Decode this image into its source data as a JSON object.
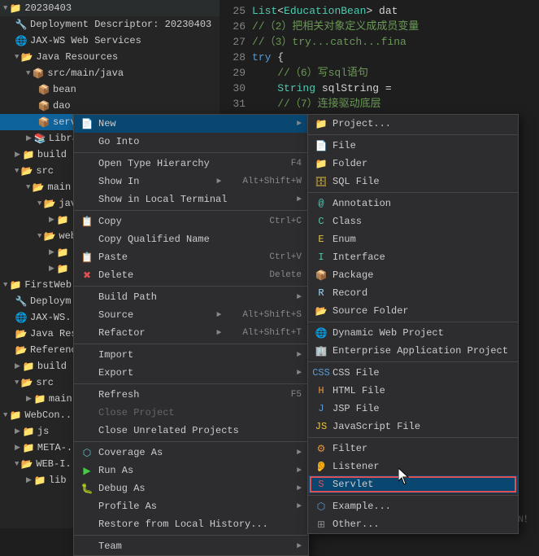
{
  "tree": {
    "items": [
      {
        "id": "20230403",
        "label": "20230403",
        "indent": 1,
        "type": "project",
        "expanded": true
      },
      {
        "id": "deployment",
        "label": "Deployment Descriptor: 20230403",
        "indent": 2,
        "type": "descriptor"
      },
      {
        "id": "jaxws",
        "label": "JAX-WS Web Services",
        "indent": 2,
        "type": "service"
      },
      {
        "id": "java-resources",
        "label": "Java Resources",
        "indent": 2,
        "type": "folder",
        "expanded": true
      },
      {
        "id": "src-main-java",
        "label": "src/main/java",
        "indent": 3,
        "type": "src",
        "expanded": true
      },
      {
        "id": "bean",
        "label": "bean",
        "indent": 4,
        "type": "package"
      },
      {
        "id": "dao",
        "label": "dao",
        "indent": 4,
        "type": "package"
      },
      {
        "id": "servlet",
        "label": "servlet",
        "indent": 4,
        "type": "package",
        "selected": true
      },
      {
        "id": "librar",
        "label": "Librar...",
        "indent": 3,
        "type": "library"
      },
      {
        "id": "build",
        "label": "build",
        "indent": 2,
        "type": "folder"
      },
      {
        "id": "src",
        "label": "src",
        "indent": 2,
        "type": "folder",
        "expanded": true
      },
      {
        "id": "main",
        "label": "main",
        "indent": 3,
        "type": "folder",
        "expanded": true
      },
      {
        "id": "jav",
        "label": "jav...",
        "indent": 4,
        "type": "folder",
        "expanded": true
      },
      {
        "id": "jav-sub1",
        "label": "►",
        "indent": 5,
        "type": "folder"
      },
      {
        "id": "web",
        "label": "web...",
        "indent": 4,
        "type": "folder",
        "expanded": true
      },
      {
        "id": "web-sub1",
        "label": "►",
        "indent": 5,
        "type": "folder"
      },
      {
        "id": "web-sub2",
        "label": "►",
        "indent": 5,
        "type": "folder"
      },
      {
        "id": "firstweb",
        "label": "FirstWeb",
        "indent": 1,
        "type": "project"
      },
      {
        "id": "deploym2",
        "label": "Deploym...",
        "indent": 2,
        "type": "descriptor"
      },
      {
        "id": "jaxws2",
        "label": "JAX-WS...",
        "indent": 2,
        "type": "service"
      },
      {
        "id": "java-res2",
        "label": "Java Res...",
        "indent": 2,
        "type": "folder"
      },
      {
        "id": "reference",
        "label": "Reference...",
        "indent": 2,
        "type": "folder"
      },
      {
        "id": "build2",
        "label": "build",
        "indent": 2,
        "type": "folder"
      },
      {
        "id": "src2",
        "label": "src",
        "indent": 2,
        "type": "folder",
        "expanded": true
      },
      {
        "id": "main2",
        "label": "main",
        "indent": 3,
        "type": "folder"
      },
      {
        "id": "webcon",
        "label": "WebCon...",
        "indent": 1,
        "type": "project",
        "expanded": true
      },
      {
        "id": "js",
        "label": "js",
        "indent": 2,
        "type": "folder"
      },
      {
        "id": "meta",
        "label": "META-...",
        "indent": 2,
        "type": "folder"
      },
      {
        "id": "web-inf",
        "label": "WEB-I...",
        "indent": 2,
        "type": "folder"
      },
      {
        "id": "lib",
        "label": "lib",
        "indent": 3,
        "type": "folder"
      }
    ]
  },
  "code": {
    "lines": [
      {
        "num": "25",
        "content": "List<EducationBean> dat"
      },
      {
        "num": "26",
        "content": "//（2）把相关对象定义成成员变量"
      },
      {
        "num": "27",
        "content": "//（3）try...catch...fina"
      },
      {
        "num": "28",
        "content": "try {"
      },
      {
        "num": "29",
        "content": "//（6）写sql语句"
      },
      {
        "num": "30",
        "content": "String sqlString ="
      },
      {
        "num": "31",
        "content": "//（7）连接驱动底层"
      }
    ]
  },
  "contextMenu": {
    "items": [
      {
        "id": "new",
        "label": "New",
        "shortcut": "",
        "hasArrow": true,
        "icon": "new-icon",
        "active": true
      },
      {
        "id": "go-into",
        "label": "Go Into",
        "shortcut": ""
      },
      {
        "id": "separator1",
        "type": "separator"
      },
      {
        "id": "open-type-hierarchy",
        "label": "Open Type Hierarchy",
        "shortcut": "F4"
      },
      {
        "id": "show-in",
        "label": "Show In",
        "shortcut": "Alt+Shift+W",
        "hasArrow": true
      },
      {
        "id": "show-local",
        "label": "Show in Local Terminal",
        "shortcut": "",
        "hasArrow": true
      },
      {
        "id": "separator2",
        "type": "separator"
      },
      {
        "id": "copy",
        "label": "Copy",
        "shortcut": "Ctrl+C",
        "icon": "copy-icon"
      },
      {
        "id": "copy-qualified",
        "label": "Copy Qualified Name",
        "shortcut": ""
      },
      {
        "id": "paste",
        "label": "Paste",
        "shortcut": "Ctrl+V",
        "icon": "paste-icon"
      },
      {
        "id": "delete",
        "label": "Delete",
        "shortcut": "Delete",
        "icon": "delete-icon"
      },
      {
        "id": "separator3",
        "type": "separator"
      },
      {
        "id": "build-path",
        "label": "Build Path",
        "shortcut": "",
        "hasArrow": true
      },
      {
        "id": "source",
        "label": "Source",
        "shortcut": "Alt+Shift+S",
        "hasArrow": true
      },
      {
        "id": "refactor",
        "label": "Refactor",
        "shortcut": "Alt+Shift+T",
        "hasArrow": true
      },
      {
        "id": "separator4",
        "type": "separator"
      },
      {
        "id": "import",
        "label": "Import",
        "shortcut": "",
        "hasArrow": true
      },
      {
        "id": "export",
        "label": "Export",
        "shortcut": "",
        "hasArrow": true
      },
      {
        "id": "separator5",
        "type": "separator"
      },
      {
        "id": "refresh",
        "label": "Refresh",
        "shortcut": "F5"
      },
      {
        "id": "close-project",
        "label": "Close Project",
        "shortcut": "",
        "disabled": true
      },
      {
        "id": "close-unrelated",
        "label": "Close Unrelated Projects",
        "shortcut": ""
      },
      {
        "id": "separator6",
        "type": "separator"
      },
      {
        "id": "coverage-as",
        "label": "Coverage As",
        "shortcut": "",
        "hasArrow": true,
        "icon": "coverage-icon"
      },
      {
        "id": "run-as",
        "label": "Run As",
        "shortcut": "",
        "hasArrow": true,
        "icon": "run-icon"
      },
      {
        "id": "debug-as",
        "label": "Debug As",
        "shortcut": "",
        "hasArrow": true,
        "icon": "debug-icon"
      },
      {
        "id": "profile-as",
        "label": "Profile As",
        "shortcut": "",
        "hasArrow": true
      },
      {
        "id": "restore",
        "label": "Restore from Local History...",
        "shortcut": ""
      },
      {
        "id": "separator7",
        "type": "separator"
      },
      {
        "id": "team",
        "label": "Team",
        "shortcut": "",
        "hasArrow": true
      }
    ]
  },
  "submenu": {
    "items": [
      {
        "id": "project",
        "label": "Project...",
        "icon": "project-icon"
      },
      {
        "id": "separator1",
        "type": "separator"
      },
      {
        "id": "file",
        "label": "File",
        "icon": "file-icon"
      },
      {
        "id": "folder",
        "label": "Folder",
        "icon": "folder-icon"
      },
      {
        "id": "sql-file",
        "label": "SQL File",
        "icon": "sql-icon"
      },
      {
        "id": "separator2",
        "type": "separator"
      },
      {
        "id": "annotation",
        "label": "Annotation",
        "icon": "annotation-icon"
      },
      {
        "id": "class",
        "label": "Class",
        "icon": "class-icon"
      },
      {
        "id": "enum",
        "label": "Enum",
        "icon": "enum-icon"
      },
      {
        "id": "interface",
        "label": "Interface",
        "icon": "interface-icon"
      },
      {
        "id": "package",
        "label": "Package",
        "icon": "package-icon"
      },
      {
        "id": "record",
        "label": "Record",
        "icon": "record-icon"
      },
      {
        "id": "source-folder",
        "label": "Source Folder",
        "icon": "source-folder-icon"
      },
      {
        "id": "separator3",
        "type": "separator"
      },
      {
        "id": "dynamic-web",
        "label": "Dynamic Web Project",
        "icon": "web-project-icon"
      },
      {
        "id": "enterprise-app",
        "label": "Enterprise Application Project",
        "icon": "enterprise-icon"
      },
      {
        "id": "separator4",
        "type": "separator"
      },
      {
        "id": "css-file",
        "label": "CSS File",
        "icon": "css-icon"
      },
      {
        "id": "html-file",
        "label": "HTML File",
        "icon": "html-icon"
      },
      {
        "id": "jsp-file",
        "label": "JSP File",
        "icon": "jsp-icon"
      },
      {
        "id": "js-file",
        "label": "JavaScript File",
        "icon": "js-icon"
      },
      {
        "id": "separator5",
        "type": "separator"
      },
      {
        "id": "filter",
        "label": "Filter",
        "icon": "filter-icon"
      },
      {
        "id": "listener",
        "label": "Listener",
        "icon": "listener-icon"
      },
      {
        "id": "servlet",
        "label": "Servlet",
        "icon": "servlet-icon",
        "highlighted": true
      },
      {
        "id": "separator6",
        "type": "separator"
      },
      {
        "id": "example",
        "label": "Example...",
        "icon": "example-icon"
      },
      {
        "id": "other",
        "label": "Other...",
        "icon": "other-icon"
      }
    ]
  },
  "watermark": "CSDN @二哈啊TN！"
}
